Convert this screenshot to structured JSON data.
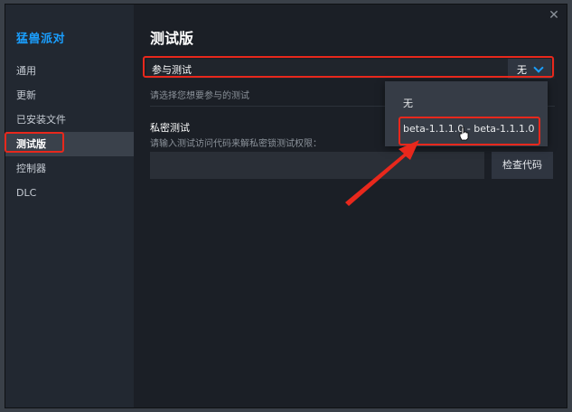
{
  "app": {
    "title": "猛兽派对"
  },
  "sidebar": {
    "items": [
      {
        "label": "通用",
        "active": false
      },
      {
        "label": "更新",
        "active": false
      },
      {
        "label": "已安装文件",
        "active": false
      },
      {
        "label": "测试版",
        "active": true
      },
      {
        "label": "控制器",
        "active": false
      },
      {
        "label": "DLC",
        "active": false
      }
    ]
  },
  "main": {
    "title": "测试版",
    "beta": {
      "label": "参与测试",
      "selected": "无",
      "hint": "请选择您想要参与的测试",
      "options": [
        "无",
        "beta-1.1.1.0 - beta-1.1.1.0"
      ]
    },
    "private": {
      "label": "私密测试",
      "hint": "请输入测试访问代码来解私密锁测试权限：",
      "input_value": "",
      "button_label": "检查代码"
    }
  },
  "colors": {
    "accent": "#1a9fff",
    "annotation": "#e8281c"
  },
  "icons": {
    "close": "close-icon",
    "chevron": "chevron-down-icon",
    "cursor": "hand-cursor-icon",
    "arrow": "arrow-annotation-icon"
  }
}
